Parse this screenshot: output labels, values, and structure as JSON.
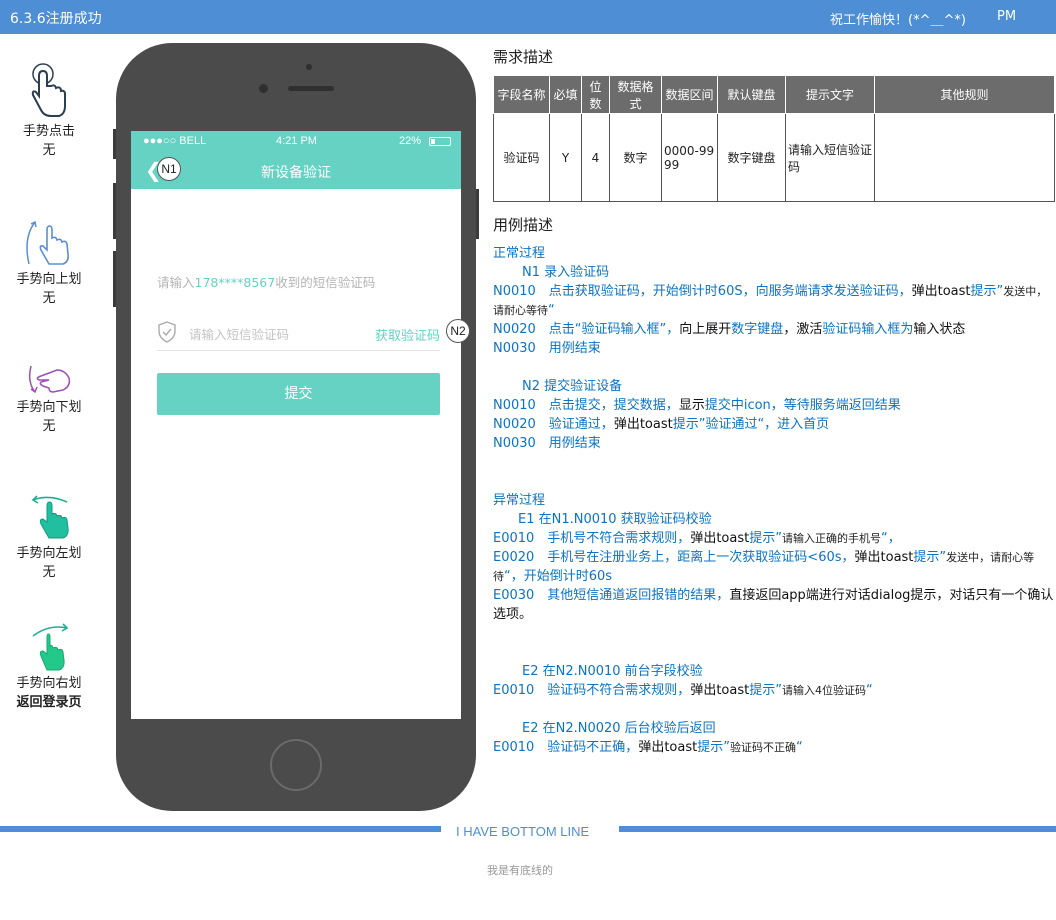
{
  "header": {
    "title": "6.3.6注册成功",
    "greeting": "祝工作愉快！(*^＿^*)",
    "role": "PM"
  },
  "gestures": [
    {
      "icon": "tap-hand-icon",
      "label": "手势点击",
      "action": "无"
    },
    {
      "icon": "swipe-up-hand-icon",
      "label": "手势向上划",
      "action": "无"
    },
    {
      "icon": "swipe-down-hand-icon",
      "label": "手势向下划",
      "action": "无"
    },
    {
      "icon": "swipe-left-hand-icon",
      "label": "手势向左划",
      "action": "无"
    },
    {
      "icon": "swipe-right-hand-icon",
      "label": "手势向右划",
      "action": "返回登录页"
    }
  ],
  "phone": {
    "status": {
      "carrier": "●●●○○ BELL",
      "time": "4:21 PM",
      "battery": "22%"
    },
    "nav_title": "新设备验证",
    "back_icon": "chevron-left-icon",
    "badge_n1": "N1",
    "badge_n2": "N2",
    "hint_prefix": "请输入",
    "hint_phone": "178****8567",
    "hint_suffix": "收到的短信验证码",
    "code_placeholder": "请输入短信验证码",
    "get_code_label": "获取验证码",
    "submit_label": "提交"
  },
  "requirements": {
    "title": "需求描述",
    "columns": [
      "字段名称",
      "必填",
      "位数",
      "数据格式",
      "数据区间",
      "默认键盘",
      "提示文字",
      "其他规则"
    ],
    "rows": [
      [
        "验证码",
        "Y",
        "4",
        "数字",
        "0000-9999",
        "数字键盘",
        "请输入短信验证码",
        ""
      ]
    ]
  },
  "usecase": {
    "title": "用例描述",
    "normal_title": "正常过程",
    "n1_title": "N1  录入验证码",
    "n1_0010_a": "N0010　点击获取验证码，开始倒计时60S，向服务端请求发送验证码，",
    "n1_0010_b": "弹出toast",
    "n1_0010_c": "提示”",
    "n1_0010_d": "发送中，请耐心等待",
    "n1_0010_e": "“",
    "n1_0020_a": "N0020　点击“验证码输入框”，",
    "n1_0020_b": "向上展开",
    "n1_0020_c": "数字键盘",
    "n1_0020_d": "，激活",
    "n1_0020_e": "验证码输入框为",
    "n1_0020_f": "输入状态",
    "n1_0030": "N0030　用例结束",
    "n2_title": "N2  提交验证设备",
    "n2_0010_a": "N0010　点击提交，提交数据，",
    "n2_0010_b": "显示",
    "n2_0010_c": "提交中icon，等待服务端返回结果",
    "n2_0020_a": "N0020　验证通过，",
    "n2_0020_b": "弹出toast",
    "n2_0020_c": "提示”验证通过“，进入首页",
    "n2_0030": "N0030　用例结束",
    "abnormal_title": "异常过程",
    "e1_title": "E1  在N1.N0010 获取验证码校验",
    "e1_0010_a": "E0010　手机号不符合需求规则，",
    "e1_0010_b": "弹出toast",
    "e1_0010_c": "提示”",
    "e1_0010_d": "请输入正确的手机号",
    "e1_0010_e": "“，",
    "e1_0020_a": "E0020　手机号在注册业务上，距离上一次获取验证码<60s，",
    "e1_0020_b": "弹出toast",
    "e1_0020_c": "提示”",
    "e1_0020_d": "发送中，请耐心等待",
    "e1_0020_e": "“，开始倒计时60s",
    "e1_0030_a": "E0030　其他短信通道返回报错的结果，",
    "e1_0030_b": "直接返回app端进行对话dialog提示，对话只有一个确认选项。",
    "e2a_title": "E2  在N2.N0010 前台字段校验",
    "e2a_0010_a": "E0010　验证码不符合需求规则，",
    "e2a_0010_b": "弹出toast",
    "e2a_0010_c": "提示”",
    "e2a_0010_d": "请输入4位验证码",
    "e2a_0010_e": "“",
    "e2b_title": "E2  在N2.N0020 后台校验后返回",
    "e2b_0010_a": "E0010　验证码不正确，",
    "e2b_0010_b": "弹出toast",
    "e2b_0010_c": "提示”",
    "e2b_0010_d": "验证码不正确",
    "e2b_0010_e": "“"
  },
  "footer": {
    "line_text": "I HAVE BOTTOM LINE",
    "sub_text": "我是有底线的"
  },
  "colors": {
    "header_blue": "#4e8ed4",
    "teal": "#66d2c4",
    "link_blue": "#0b74c4",
    "phone_body": "#4b4b4b"
  }
}
